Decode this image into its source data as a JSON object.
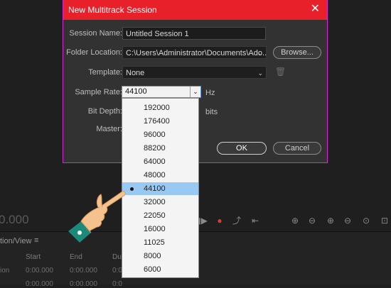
{
  "dialog": {
    "title": "New Multitrack Session",
    "session_name_label": "Session Name:",
    "session_name_value": "Untitled Session 1",
    "folder_location_label": "Folder Location:",
    "folder_location_value": "C:\\Users\\Administrator\\Documents\\Ado...",
    "browse_label": "Browse...",
    "template_label": "Template:",
    "template_value": "None",
    "sample_rate_label": "Sample Rate:",
    "sample_rate_value": "44100",
    "sample_rate_unit": "Hz",
    "bit_depth_label": "Bit Depth:",
    "bit_depth_unit": "bits",
    "master_label": "Master:",
    "ok_label": "OK",
    "cancel_label": "Cancel"
  },
  "sample_rate_options": [
    "192000",
    "176400",
    "96000",
    "88200",
    "64000",
    "48000",
    "44100",
    "32000",
    "22050",
    "16000",
    "11025",
    "8000",
    "6000"
  ],
  "selected_index": 6,
  "background": {
    "time": "0.000",
    "panel_title": "tion/View",
    "panel_menu": "≡",
    "col_start": "Start",
    "col_end": "End",
    "col_dur": "Du",
    "row1_label": "ion",
    "row1_start": "0:00.000",
    "row1_end": "0:00.000",
    "row1_dur": "0:0",
    "row2_start": "0:00.000",
    "row2_end": "0:00.000",
    "row2_dur": "0:0"
  },
  "colors": {
    "titlebar": "#e8202a",
    "dialog_border": "#d62ad6",
    "selection": "#99c9f2"
  }
}
